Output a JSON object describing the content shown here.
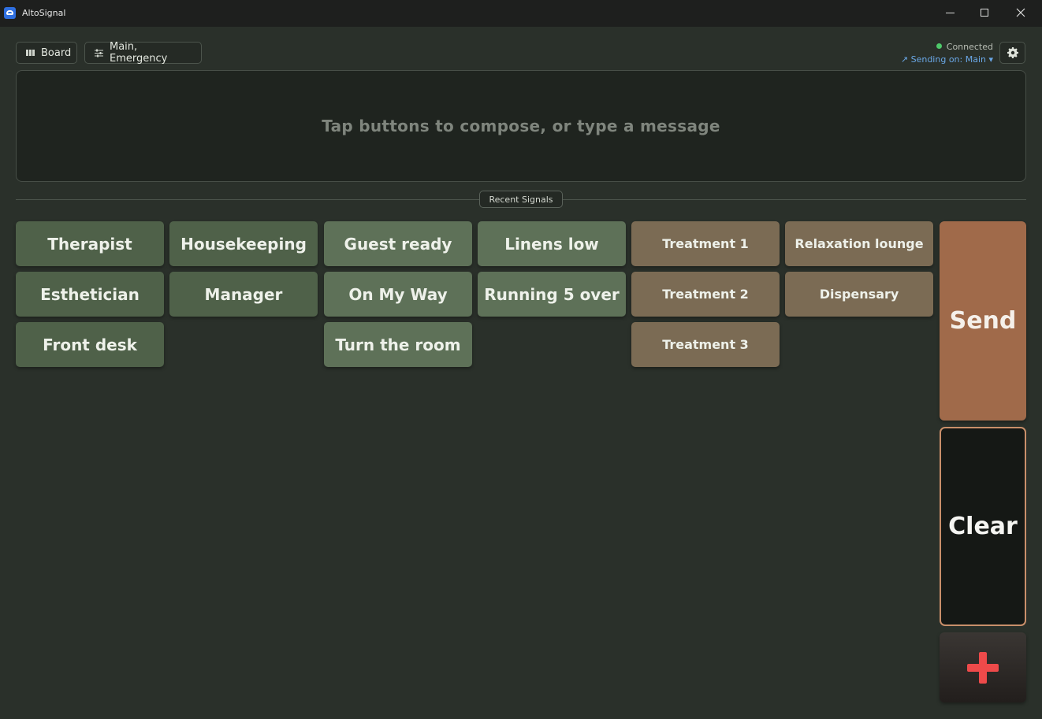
{
  "window": {
    "title": "AltoSignal"
  },
  "toolbar": {
    "board_label": "Board",
    "channels_label": "Main, Emergency"
  },
  "status": {
    "connection": "Connected",
    "connection_color": "#4ec96a",
    "sending": "↗ Sending on: Main ▾"
  },
  "compose": {
    "placeholder": "Tap buttons to compose, or type a message"
  },
  "recent": {
    "label": "Recent Signals"
  },
  "signals": {
    "therapist": "Therapist",
    "housekeeping": "Housekeeping",
    "guest_ready": "Guest ready",
    "linens_low": "Linens low",
    "treatment_1": "Treatment 1",
    "relaxation_lounge": "Relaxation lounge",
    "esthetician": "Esthetician",
    "manager": "Manager",
    "on_my_way": "On My Way",
    "running_5_over": "Running 5 over",
    "treatment_2": "Treatment 2",
    "dispensary": "Dispensary",
    "front_desk": "Front desk",
    "turn_the_room": "Turn the room",
    "treatment_3": "Treatment 3"
  },
  "actions": {
    "send": "Send",
    "clear": "Clear",
    "emergency_icon": "plus-icon",
    "send_color": "#a06a4a",
    "emergency_color": "#ee4a4a"
  }
}
